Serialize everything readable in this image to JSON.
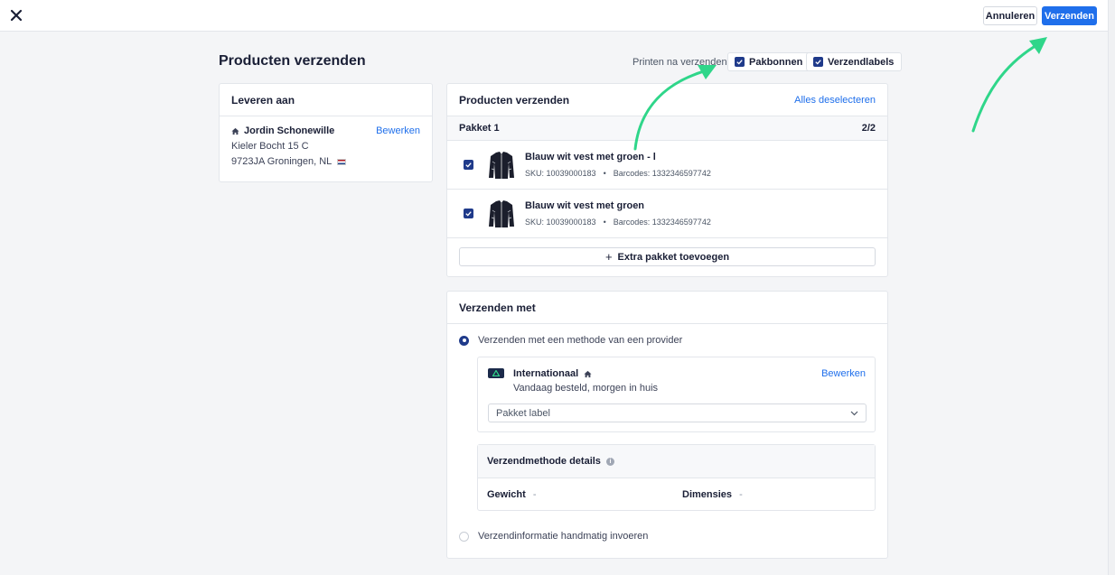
{
  "topbar": {
    "close_icon": "close-icon",
    "cancel_label": "Annuleren",
    "send_label": "Verzenden"
  },
  "page": {
    "title": "Producten verzenden",
    "print_label": "Printen na verzenden:",
    "print_options": [
      {
        "label": "Pakbonnen",
        "checked": true
      },
      {
        "label": "Verzendlabels",
        "checked": true
      }
    ]
  },
  "deliver": {
    "title": "Leveren aan",
    "name": "Jordin Schonewille",
    "edit_label": "Bewerken",
    "street": "Kieler Bocht 15 C",
    "city": "9723JA Groningen, NL"
  },
  "products": {
    "title": "Producten verzenden",
    "deselect_label": "Alles deselecteren",
    "package_label": "Pakket 1",
    "package_count": "2/2",
    "items": [
      {
        "name": "Blauw wit vest met groen - l",
        "sku": "SKU: 10039000183",
        "barcode": "Barcodes: 1332346597742",
        "checked": true
      },
      {
        "name": "Blauw wit vest met groen",
        "sku": "SKU: 10039000183",
        "barcode": "Barcodes: 1332346597742",
        "checked": true
      }
    ],
    "add_package_label": "Extra pakket toevoegen"
  },
  "shipping": {
    "title": "Verzenden met",
    "option_provider": "Verzenden met een methode van een provider",
    "provider_name": "Internationaal",
    "provider_desc": "Vandaag besteld, morgen in huis",
    "provider_edit": "Bewerken",
    "select_value": "Pakket label",
    "details_title": "Verzendmethode details",
    "weight_label": "Gewicht",
    "weight_value": "-",
    "dimensions_label": "Dimensies",
    "dimensions_value": "-",
    "option_manual": "Verzendinformatie handmatig invoeren"
  },
  "colors": {
    "primary": "#1f6feb",
    "checkbox": "#1f3a8a",
    "arrow": "#2fd68a"
  }
}
